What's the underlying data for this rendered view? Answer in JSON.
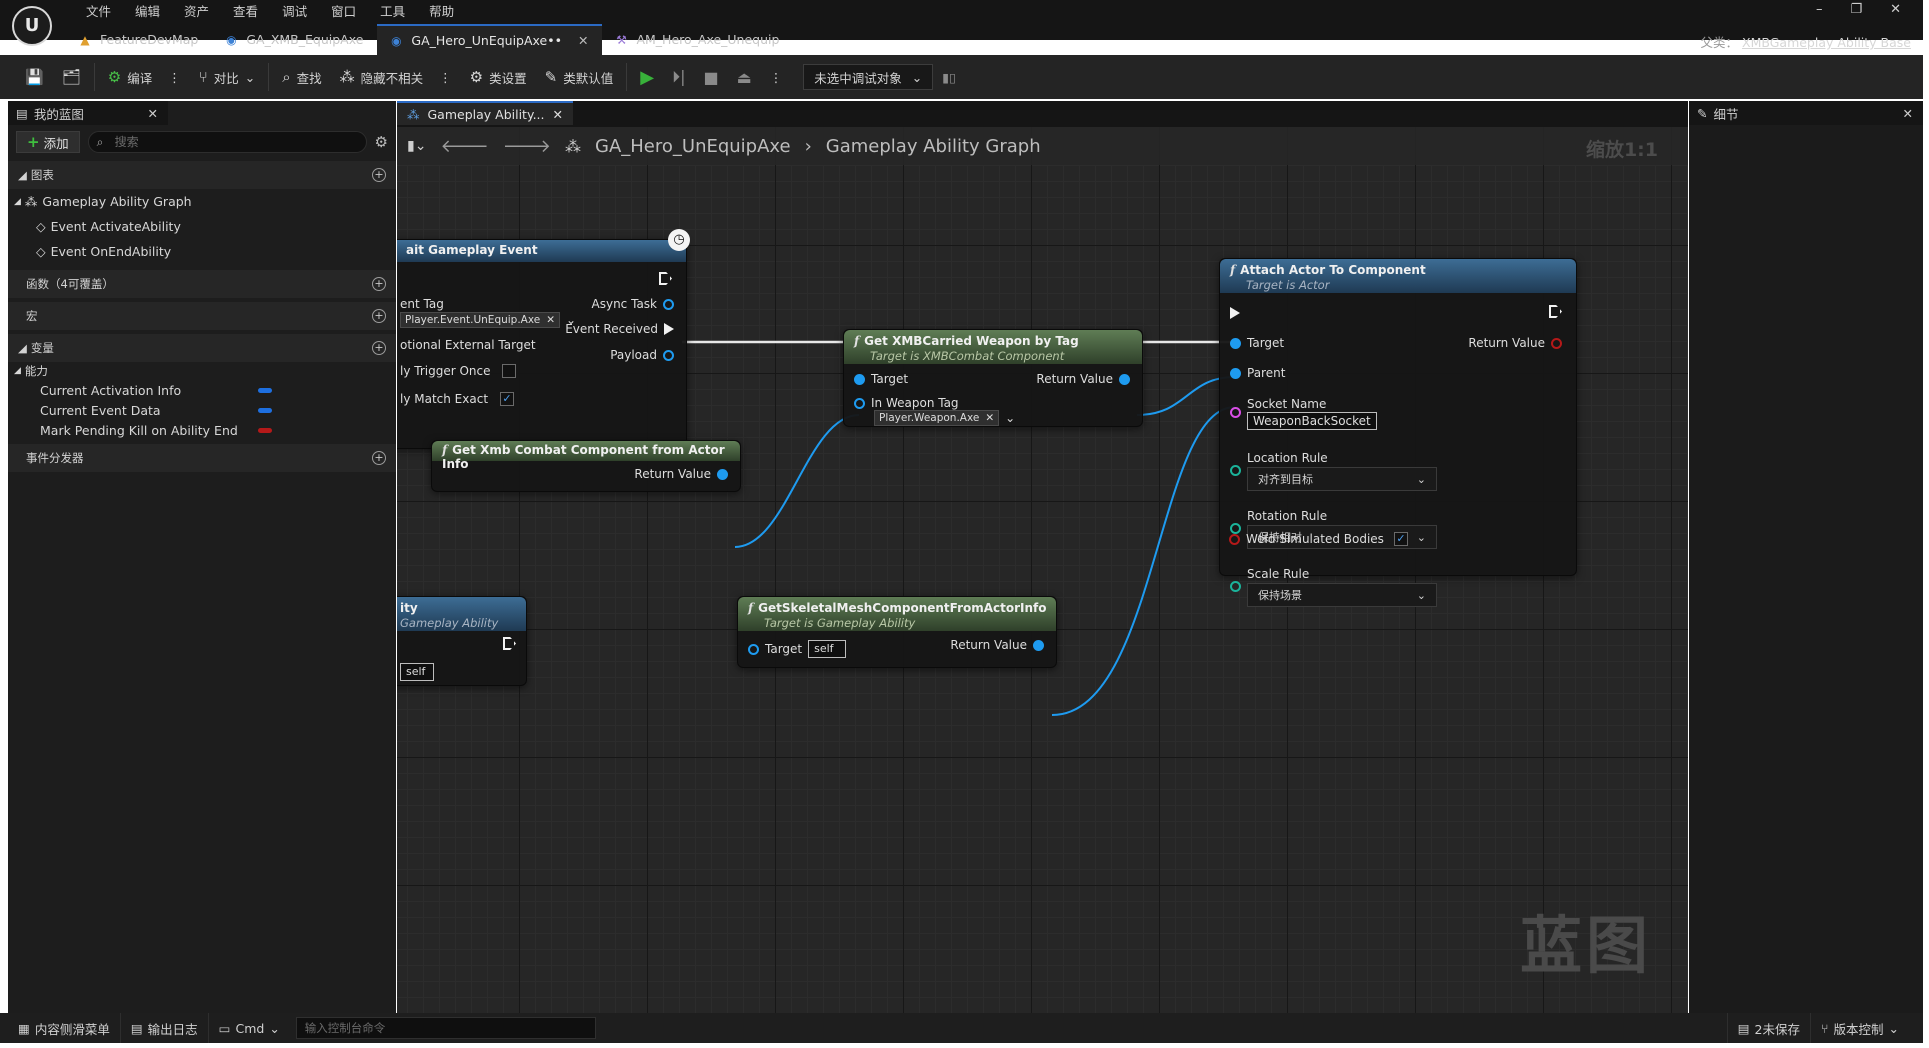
{
  "menu": [
    "文件",
    "编辑",
    "资产",
    "查看",
    "调试",
    "窗口",
    "工具",
    "帮助"
  ],
  "tabs": [
    {
      "label": "FeatureDevMap"
    },
    {
      "label": "GA_XMB_EquipAxe"
    },
    {
      "label": "GA_Hero_UnEquipAxe••"
    },
    {
      "label": "AM_Hero_Axe_Unequip"
    }
  ],
  "window": {
    "minimize": "–",
    "restore": "❐",
    "close": "✕"
  },
  "parent_class": {
    "label": "父类：",
    "value": "XMBGameplay Ability Base"
  },
  "toolbar": {
    "compile": "编译",
    "diff": "对比",
    "find": "查找",
    "hide_unrelated": "隐藏不相关",
    "class_settings": "类设置",
    "class_defaults": "类默认值",
    "debug_target": "未选中调试对象"
  },
  "left_panel": {
    "tab": "我的蓝图",
    "add": "添加",
    "search_placeholder": "搜索",
    "graphs_header": "图表",
    "graph_name": "Gameplay Ability Graph",
    "events": [
      "Event ActivateAbility",
      "Event OnEndAbility"
    ],
    "functions_header": "函数（4可覆盖）",
    "macros_header": "宏",
    "variables_header": "变量",
    "category": "能力",
    "variables": [
      {
        "name": "Current Activation Info",
        "color": "#1e6fe0"
      },
      {
        "name": "Current Event Data",
        "color": "#1e6fe0"
      },
      {
        "name": "Mark Pending Kill on Ability End",
        "color": "#b51919"
      }
    ],
    "dispatchers_header": "事件分发器"
  },
  "graph": {
    "tab": "Gameplay Ability...",
    "breadcrumb_bp": "GA_Hero_UnEquipAxe",
    "breadcrumb_graph": "Gameplay Ability Graph",
    "zoom": "缩放1:1",
    "watermark": "蓝图"
  },
  "nodes": {
    "wait_event": {
      "title": "ait Gameplay Event",
      "event_tag": "ent Tag",
      "event_tag_value": "Player.Event.UnEquip.Axe",
      "optional_target": "otional External Target",
      "trigger_once": "ly Trigger Once",
      "match_exact": "ly Match Exact",
      "async_task": "Async Task",
      "event_received": "Event Received",
      "payload": "Payload"
    },
    "get_weapon": {
      "title": "Get XMBCarried Weapon by Tag",
      "subtitle": "Target is XMBCombat Component",
      "target": "Target",
      "in_tag": "In Weapon Tag",
      "in_tag_value": "Player.Weapon.Axe",
      "return_value": "Return Value"
    },
    "get_combat": {
      "title": "Get Xmb Combat Component from Actor Info",
      "return_value": "Return Value"
    },
    "attach": {
      "title": "Attach Actor To Component",
      "subtitle": "Target is Actor",
      "target": "Target",
      "parent": "Parent",
      "return_value": "Return Value",
      "socket_name": "Socket Name",
      "socket_value": "WeaponBackSocket",
      "location_rule": "Location Rule",
      "location_value": "对齐到目标",
      "rotation_rule": "Rotation Rule",
      "rotation_value": "保持相对",
      "scale_rule": "Scale Rule",
      "scale_value": "保持场景",
      "weld": "Weld Simulated Bodies"
    },
    "get_mesh": {
      "title": "GetSkeletalMeshComponentFromActorInfo",
      "subtitle": "Target is Gameplay Ability",
      "target": "Target",
      "target_value": "self",
      "return_value": "Return Value"
    },
    "end_ability": {
      "title": "ity",
      "subtitle": "Gameplay Ability",
      "target_value": "self"
    }
  },
  "right_panel": {
    "tab": "细节"
  },
  "status": {
    "content_drawer": "内容侧滑菜单",
    "output_log": "输出日志",
    "cmd": "Cmd",
    "cmd_placeholder": "输入控制台命令",
    "unsaved": "2未保存",
    "source_control": "版本控制"
  }
}
